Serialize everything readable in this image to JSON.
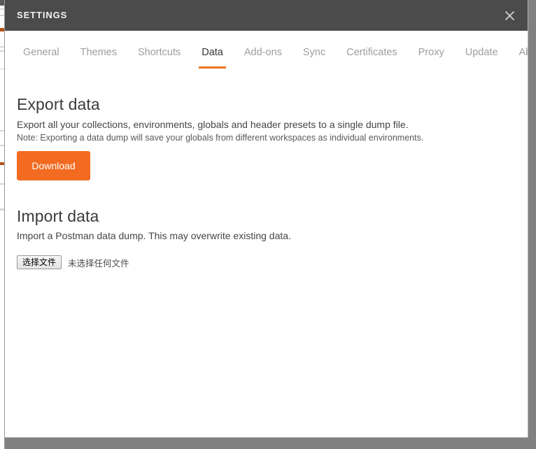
{
  "window": {
    "title": "SETTINGS",
    "close_icon": "close-icon",
    "titlebar_color": "#4b4b4b"
  },
  "theme": {
    "accent": "#ef7623",
    "button_orange": "#f26b21",
    "tab_inactive": "#9e9e9e",
    "tab_active": "#363636"
  },
  "tabs": [
    {
      "label": "General",
      "active": false
    },
    {
      "label": "Themes",
      "active": false
    },
    {
      "label": "Shortcuts",
      "active": false
    },
    {
      "label": "Data",
      "active": true
    },
    {
      "label": "Add-ons",
      "active": false
    },
    {
      "label": "Sync",
      "active": false
    },
    {
      "label": "Certificates",
      "active": false
    },
    {
      "label": "Proxy",
      "active": false
    },
    {
      "label": "Update",
      "active": false
    },
    {
      "label": "About",
      "active": false
    }
  ],
  "export": {
    "title": "Export data",
    "description": "Export all your collections, environments, globals and header presets to a single dump file.",
    "note": "Note: Exporting a data dump will save your globals from different workspaces as individual environments.",
    "download_label": "Download"
  },
  "import": {
    "title": "Import data",
    "description": "Import a Postman data dump. This may overwrite existing data.",
    "choose_file_label": "选择文件",
    "file_status": "未选择任何文件"
  }
}
